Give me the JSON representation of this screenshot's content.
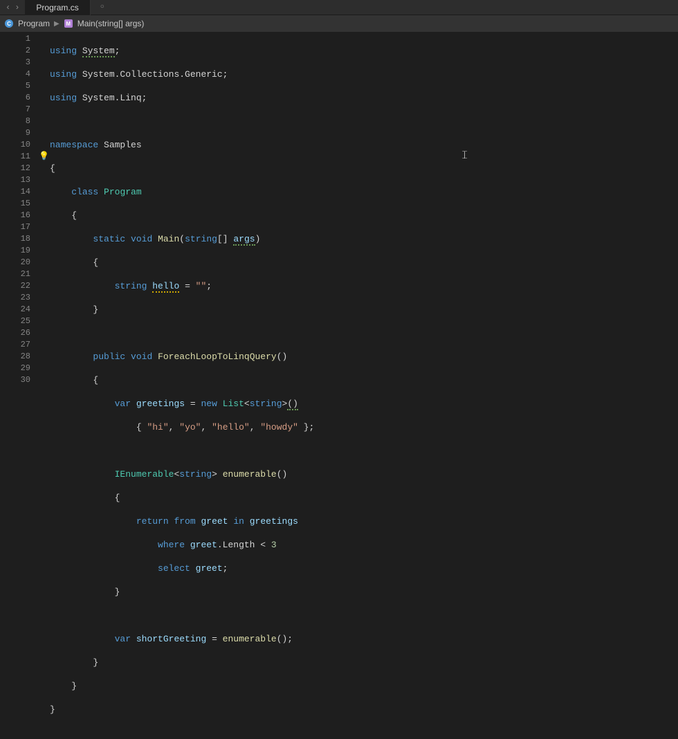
{
  "tab": {
    "title": "Program.cs"
  },
  "breadcrumb": {
    "program_label": "Program",
    "method_label": "Main(string[] args)"
  },
  "line_numbers": [
    "1",
    "2",
    "3",
    "4",
    "5",
    "6",
    "7",
    "8",
    "9",
    "10",
    "11",
    "12",
    "13",
    "14",
    "15",
    "16",
    "17",
    "18",
    "19",
    "20",
    "21",
    "22",
    "23",
    "24",
    "25",
    "26",
    "27",
    "28",
    "29",
    "30"
  ],
  "code": {
    "l1": {
      "using": "using",
      "ns": "System",
      "semi": ";"
    },
    "l2": {
      "using": "using",
      "ns": "System.Collections.Generic",
      "semi": ";"
    },
    "l3": {
      "using": "using",
      "ns": "System.Linq",
      "semi": ";"
    },
    "l5": {
      "kw": "namespace",
      "name": "Samples"
    },
    "l6": {
      "brace": "{"
    },
    "l7": {
      "kw": "class",
      "name": "Program"
    },
    "l8": {
      "brace": "{"
    },
    "l9": {
      "static": "static",
      "void": "void",
      "name": "Main",
      "open": "(",
      "type": "string",
      "arr": "[]",
      "sp": " ",
      "param": "args",
      "close": ")"
    },
    "l10": {
      "brace": "{"
    },
    "l11": {
      "type": "string",
      "var": "hello",
      "eq": " = ",
      "str": "\"\"",
      "semi": ";"
    },
    "l12": {
      "brace": "}"
    },
    "l14": {
      "public": "public",
      "void": "void",
      "name": "ForeachLoopToLinqQuery",
      "parens": "()"
    },
    "l15": {
      "brace": "{"
    },
    "l16": {
      "var": "var",
      "name": "greetings",
      "eq": " = ",
      "new": "new",
      "list": "List",
      "lt": "<",
      "str": "string",
      "gt": ">",
      "parens": "()"
    },
    "l17": {
      "open": "{ ",
      "s1": "\"hi\"",
      "c1": ", ",
      "s2": "\"yo\"",
      "c2": ", ",
      "s3": "\"hello\"",
      "c3": ", ",
      "s4": "\"howdy\"",
      "close": " };"
    },
    "l19": {
      "ienum": "IEnumerable",
      "lt": "<",
      "str": "string",
      "gt": "> ",
      "name": "enumerable",
      "parens": "()"
    },
    "l20": {
      "brace": "{"
    },
    "l21": {
      "return": "return",
      "from": "from",
      "var": "greet",
      "in": "in",
      "src": "greetings"
    },
    "l22": {
      "where": "where",
      "var": "greet",
      "dot": ".Length < ",
      "num": "3"
    },
    "l23": {
      "select": "select",
      "var": "greet",
      "semi": ";"
    },
    "l24": {
      "brace": "}"
    },
    "l26": {
      "var": "var",
      "name": "shortGreeting",
      "eq": " = ",
      "call": "enumerable",
      "parens": "();"
    },
    "l27": {
      "brace": "}"
    },
    "l28": {
      "brace": "}"
    },
    "l29": {
      "brace": "}"
    }
  }
}
